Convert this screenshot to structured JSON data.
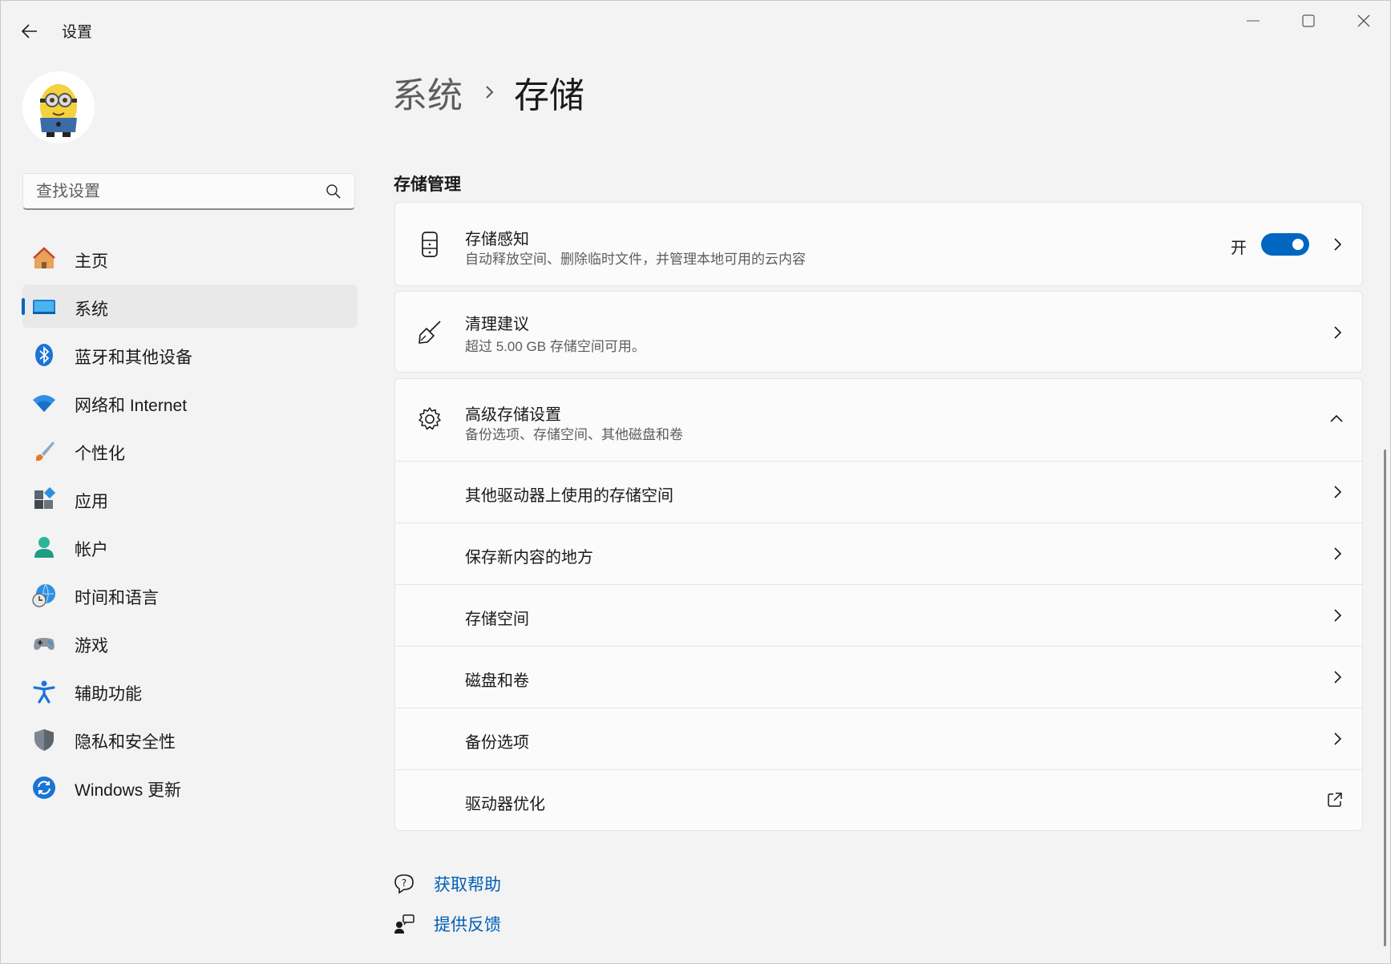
{
  "window": {
    "title": "设置"
  },
  "search": {
    "placeholder": "查找设置"
  },
  "sidebar": {
    "items": [
      {
        "label": "主页",
        "icon": "home-icon"
      },
      {
        "label": "系统",
        "icon": "system-display-icon",
        "active": true
      },
      {
        "label": "蓝牙和其他设备",
        "icon": "bluetooth-icon"
      },
      {
        "label": "网络和 Internet",
        "icon": "wifi-icon"
      },
      {
        "label": "个性化",
        "icon": "paintbrush-icon"
      },
      {
        "label": "应用",
        "icon": "apps-icon"
      },
      {
        "label": "帐户",
        "icon": "account-icon"
      },
      {
        "label": "时间和语言",
        "icon": "globe-clock-icon"
      },
      {
        "label": "游戏",
        "icon": "gamepad-icon"
      },
      {
        "label": "辅助功能",
        "icon": "accessibility-icon"
      },
      {
        "label": "隐私和安全性",
        "icon": "shield-icon"
      },
      {
        "label": "Windows 更新",
        "icon": "windows-update-icon"
      }
    ]
  },
  "breadcrumb": {
    "parent": "系统",
    "current": "存储"
  },
  "section": {
    "title": "存储管理"
  },
  "storage_sense": {
    "title": "存储感知",
    "subtitle": "自动释放空间、删除临时文件，并管理本地可用的云内容",
    "toggle_label": "开",
    "toggle_on": true
  },
  "cleanup": {
    "title": "清理建议",
    "subtitle": "超过 5.00 GB 存储空间可用。"
  },
  "advanced": {
    "title": "高级存储设置",
    "subtitle": "备份选项、存储空间、其他磁盘和卷",
    "expanded": true,
    "items": [
      {
        "label": "其他驱动器上使用的存储空间",
        "action": "chevron"
      },
      {
        "label": "保存新内容的地方",
        "action": "chevron"
      },
      {
        "label": "存储空间",
        "action": "chevron"
      },
      {
        "label": "磁盘和卷",
        "action": "chevron"
      },
      {
        "label": "备份选项",
        "action": "chevron"
      },
      {
        "label": "驱动器优化",
        "action": "external-link"
      }
    ]
  },
  "links": {
    "help": "获取帮助",
    "feedback": "提供反馈"
  },
  "colors": {
    "accent": "#0067c0",
    "link": "#005fb8",
    "background": "#f3f3f3"
  }
}
